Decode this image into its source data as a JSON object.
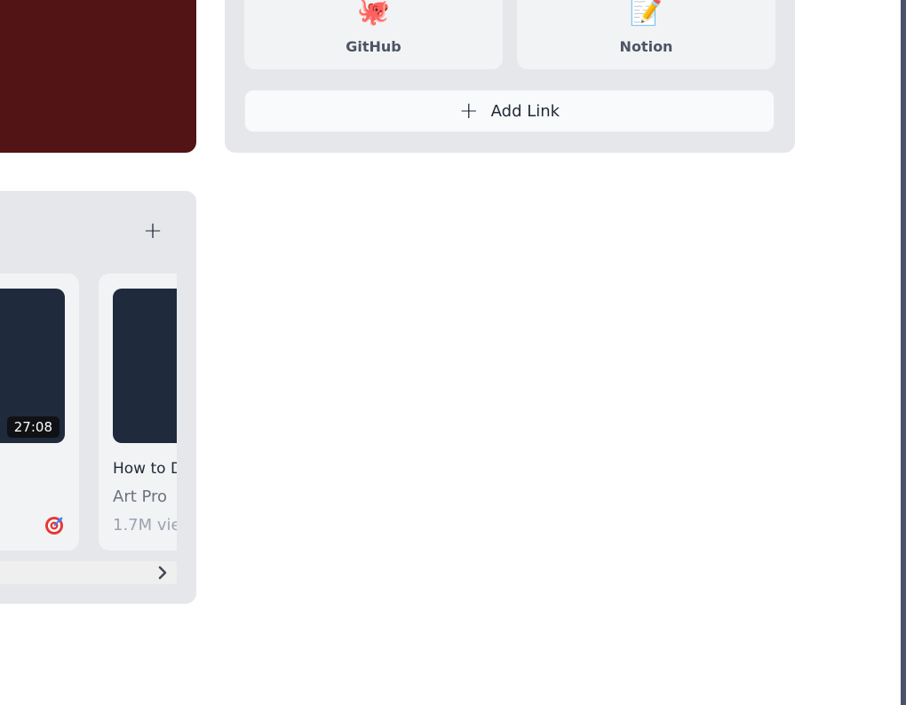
{
  "links": {
    "items": [
      {
        "label": "GitHub",
        "icon": "octopus-emoji",
        "emoji": "🐙"
      },
      {
        "label": "Notion",
        "icon": "memo-emoji",
        "emoji": "📝"
      }
    ],
    "add_label": "Add Link",
    "add_icon": "+"
  },
  "videos": {
    "add_icon": "+",
    "cards": [
      {
        "duration": "27:08",
        "badge_icon": "target-icon"
      },
      {
        "title": "How to D",
        "channel": "Art Pro",
        "views": "1.7M vie"
      }
    ]
  },
  "colors": {
    "hero_bg": "#521414",
    "panel_bg": "#e5e7eb",
    "tile_bg": "#f2f3f5",
    "thumb_bg": "#1f2a3c",
    "edge_strip": "#4a5368"
  }
}
